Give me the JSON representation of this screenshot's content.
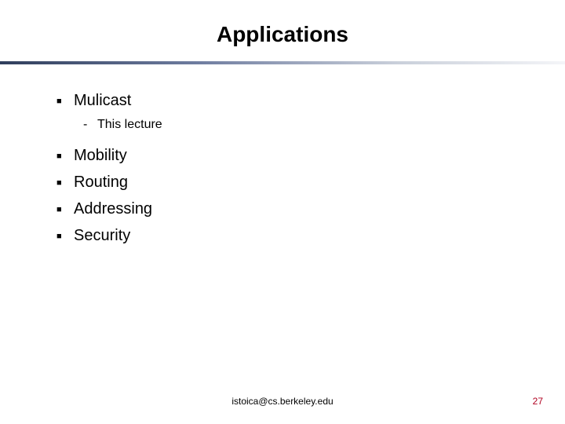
{
  "title": "Applications",
  "bullets": {
    "b0": "Mulicast",
    "b0_sub": "This lecture",
    "b1": "Mobility",
    "b2": "Routing",
    "b3": "Addressing",
    "b4": "Security"
  },
  "footer": "istoica@cs.berkeley.edu",
  "page": "27"
}
